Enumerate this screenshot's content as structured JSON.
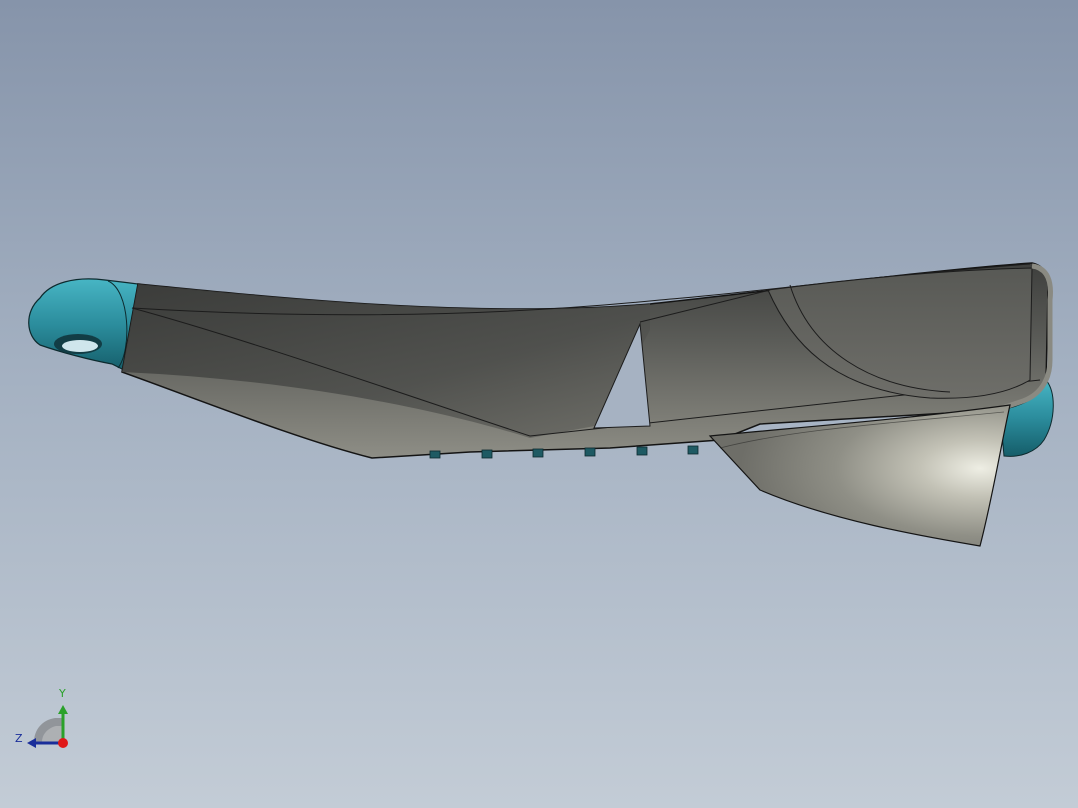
{
  "viewport": {
    "background_top": "#8694aa",
    "background_bottom": "#c3ccd6"
  },
  "model": {
    "shell_color": "#5a5b57",
    "highlight_color": "#e6e6db",
    "accent_color": "#2b8c9c"
  },
  "triad": {
    "y_label": "Y",
    "z_label": "Z",
    "y_color": "#2aa12a",
    "z_color": "#1a2e9a",
    "x_color": "#e01818",
    "icon": "coordinate-triad-icon"
  }
}
